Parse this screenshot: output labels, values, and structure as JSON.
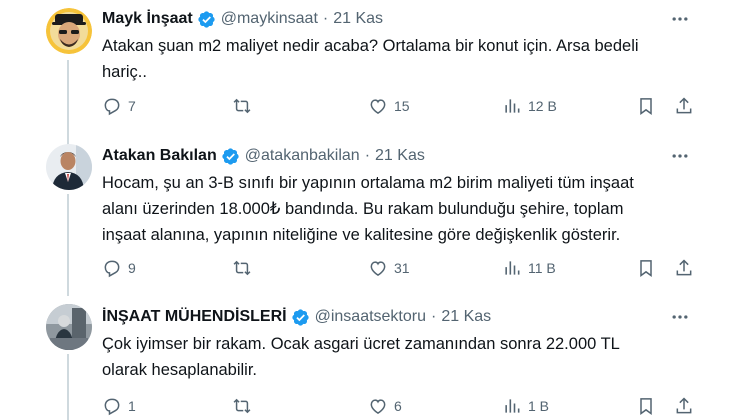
{
  "tweets": [
    {
      "name": "Mayk İnşaat",
      "handle": "@maykinsaat",
      "separator": "·",
      "date": "21 Kas",
      "text": "Atakan şuan m2 maliyet nedir acaba? Ortalama bir konut için. Arsa bedeli\nhariç..",
      "replies": "7",
      "retweets": "",
      "likes": "15",
      "views": "12 B"
    },
    {
      "name": "Atakan Bakılan",
      "handle": "@atakanbakilan",
      "separator": "·",
      "date": "21 Kas",
      "text": "Hocam, şu an 3-B sınıfı bir yapının ortalama m2 birim maliyeti tüm inşaat\nalanı üzerinden 18.000₺ bandında. Bu rakam bulunduğu şehire, toplam\ninşaat alanına, yapının niteliğine ve kalitesine göre değişkenlik gösterir.",
      "replies": "9",
      "retweets": "",
      "likes": "31",
      "views": "11 B"
    },
    {
      "name": "İNŞAAT MÜHENDİSLERİ",
      "handle": "@insaatsektoru",
      "separator": "·",
      "date": "21 Kas",
      "text": "Çok iyimser bir rakam. Ocak asgari ücret zamanından sonra 22.000 TL\nolarak hesaplanabilir.",
      "replies": "1",
      "retweets": "",
      "likes": "6",
      "views": "1 B"
    }
  ],
  "icons": {
    "reply": "reply-icon",
    "retweet": "retweet-icon",
    "like": "heart-icon",
    "views": "views-icon",
    "bookmark": "bookmark-icon",
    "share": "share-icon",
    "verified": "verified-badge-icon",
    "more": "more-icon"
  },
  "colors": {
    "verified": "#1d9bf0",
    "text": "#0f1419",
    "secondary": "#536471",
    "thread_line": "#cfd9de"
  }
}
